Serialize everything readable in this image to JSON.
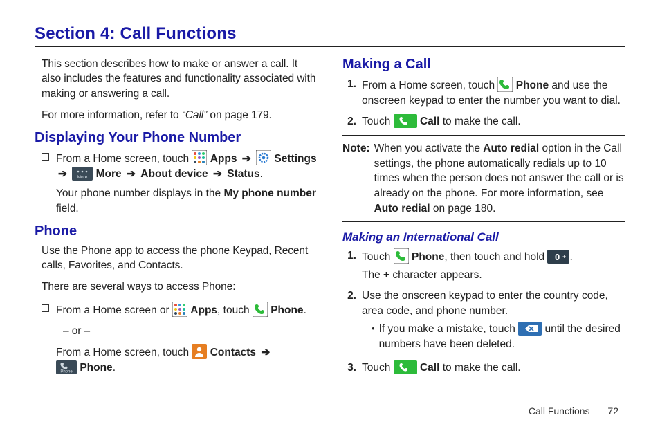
{
  "title": "Section 4: Call Functions",
  "intro": {
    "p1": "This section describes how to make or answer a call. It also includes the features and functionality associated with making or answering a call.",
    "p2a": "For more information, refer to ",
    "p2_ref": "“Call”",
    "p2b": " on page 179."
  },
  "displaying": {
    "heading": "Displaying Your Phone Number",
    "line1a": "From a Home screen, touch ",
    "apps": "Apps",
    "settings": "Settings",
    "more": "More",
    "about": "About device",
    "status": "Status",
    "line2a": "Your phone number displays in the ",
    "myphone": "My phone number",
    "line2b": " field."
  },
  "phone": {
    "heading": "Phone",
    "p1": "Use the Phone app to access the phone Keypad, Recent calls, Favorites, and Contacts.",
    "p2": "There are several ways to access Phone:",
    "b1a": "From a Home screen or ",
    "apps": "Apps",
    "touch": ", touch ",
    "phone": "Phone",
    "or": "– or –",
    "b2a": "From a Home screen, touch ",
    "contacts": "Contacts"
  },
  "making": {
    "heading": "Making a Call",
    "s1a": "From a Home screen, touch ",
    "phone": "Phone",
    "s1b": " and use the onscreen keypad to enter the number you want to dial.",
    "s2a": "Touch ",
    "call": "Call",
    "s2b": " to make the call."
  },
  "note": {
    "lead": "Note:",
    "t1": "When you activate the ",
    "autoredial": "Auto redial",
    "t2": " option in the Call settings, the phone automatically redials up to 10 times when the person does not answer the call or is already on the phone. For more information, see ",
    "t3": " on page 180."
  },
  "intl": {
    "heading": "Making an International Call",
    "s1a": "Touch ",
    "phone": "Phone",
    "s1b": ", then touch and hold ",
    "s1c": "The ",
    "plus": "+",
    "s1d": " character appears.",
    "s2": "Use the onscreen keypad to enter the country code, area code, and phone number.",
    "sub_a": "If you make a mistake, touch ",
    "sub_b": " until the desired numbers have been deleted.",
    "s3a": "Touch ",
    "call": "Call",
    "s3b": " to make the call."
  },
  "footer": {
    "label": "Call Functions",
    "page": "72"
  }
}
